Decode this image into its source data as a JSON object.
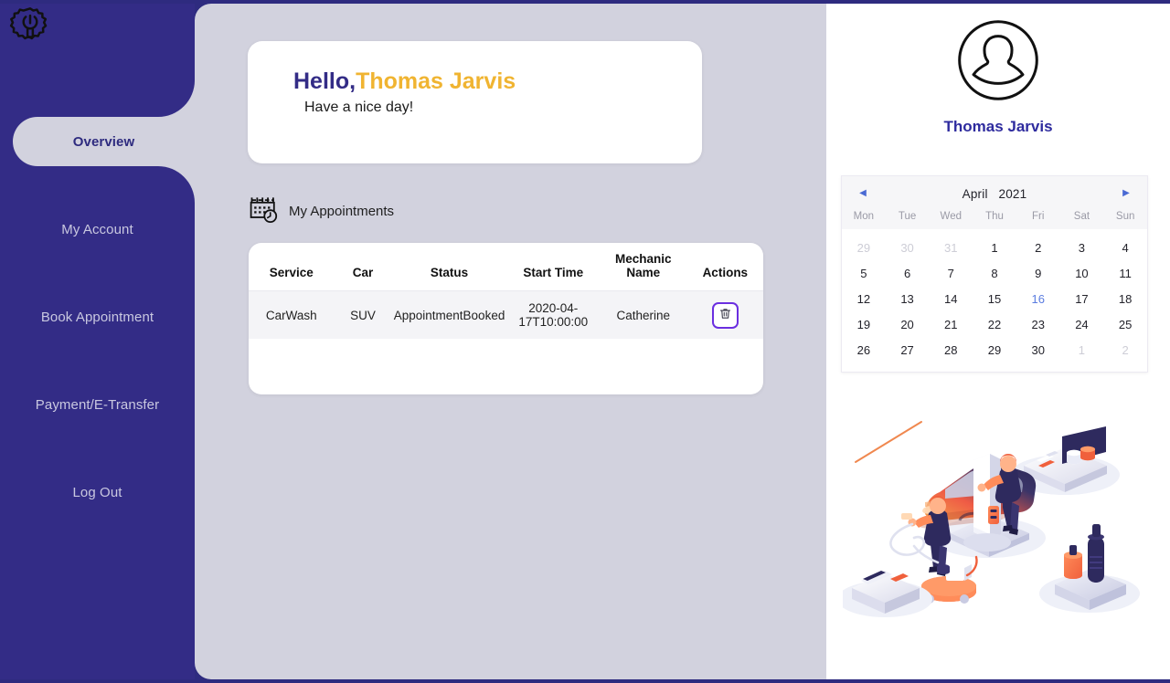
{
  "brand": {
    "logo_icon": "gear-wrench-icon",
    "sidebar_color": "#332c86",
    "accent_color": "#f0b431",
    "content_bg": "#d2d2de"
  },
  "sidebar": {
    "items": [
      {
        "label": "Overview",
        "active": true
      },
      {
        "label": "My Account",
        "active": false
      },
      {
        "label": "Book Appointment",
        "active": false
      },
      {
        "label": "Payment/E-Transfer",
        "active": false
      },
      {
        "label": "Log Out",
        "active": false
      }
    ]
  },
  "greeting": {
    "hello": "Hello,",
    "name": "Thomas Jarvis",
    "subtitle": "Have a nice day!"
  },
  "appointments": {
    "section_icon": "calendar-clock-icon",
    "section_title": "My Appointments",
    "columns": [
      "Service",
      "Car",
      "Status",
      "Start Time",
      "Mechanic Name",
      "Actions"
    ],
    "rows": [
      {
        "service": "CarWash",
        "car": "SUV",
        "status": "AppointmentBooked",
        "start_time": "2020-04-17T10:00:00",
        "mechanic_name": "Catherine",
        "action_icon": "trash-icon"
      }
    ]
  },
  "profile": {
    "avatar_icon": "user-avatar-icon",
    "name": "Thomas Jarvis"
  },
  "calendar": {
    "prev_icon": "chevron-left-icon",
    "next_icon": "chevron-right-icon",
    "month": "April",
    "year": "2021",
    "dow": [
      "Mon",
      "Tue",
      "Wed",
      "Thu",
      "Fri",
      "Sat",
      "Sun"
    ],
    "today": "16",
    "highlight_color": "#5b7de0",
    "weeks": [
      [
        {
          "d": "29",
          "muted": true
        },
        {
          "d": "30",
          "muted": true
        },
        {
          "d": "31",
          "muted": true
        },
        {
          "d": "1"
        },
        {
          "d": "2"
        },
        {
          "d": "3"
        },
        {
          "d": "4"
        }
      ],
      [
        {
          "d": "5"
        },
        {
          "d": "6"
        },
        {
          "d": "7"
        },
        {
          "d": "8"
        },
        {
          "d": "9"
        },
        {
          "d": "10"
        },
        {
          "d": "11"
        }
      ],
      [
        {
          "d": "12"
        },
        {
          "d": "13"
        },
        {
          "d": "14"
        },
        {
          "d": "15"
        },
        {
          "d": "16",
          "today": true
        },
        {
          "d": "17"
        },
        {
          "d": "18"
        }
      ],
      [
        {
          "d": "19"
        },
        {
          "d": "20"
        },
        {
          "d": "21"
        },
        {
          "d": "22"
        },
        {
          "d": "23"
        },
        {
          "d": "24"
        },
        {
          "d": "25"
        }
      ],
      [
        {
          "d": "26"
        },
        {
          "d": "27"
        },
        {
          "d": "28"
        },
        {
          "d": "29"
        },
        {
          "d": "30"
        },
        {
          "d": "1",
          "muted": true
        },
        {
          "d": "2",
          "muted": true
        }
      ]
    ]
  },
  "illustration": {
    "name": "car-service-isometric-illustration"
  }
}
